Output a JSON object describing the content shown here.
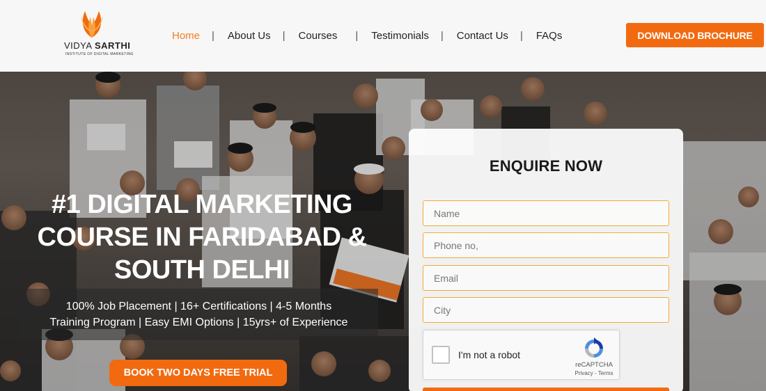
{
  "brand": {
    "name_part1": "VIDYA ",
    "name_part2": "SARTHI",
    "tagline": "INSTITUTE OF DIGITAL MARKETING",
    "accent_color": "#f26a10"
  },
  "nav": {
    "items": [
      {
        "label": "Home",
        "active": true
      },
      {
        "label": "About Us"
      },
      {
        "label": "Courses"
      },
      {
        "label": "Testimonials"
      },
      {
        "label": "Contact Us"
      },
      {
        "label": "FAQs"
      }
    ],
    "separator": "|"
  },
  "header": {
    "download_button": "DOWNLOAD BROCHURE"
  },
  "hero": {
    "headline_line1": "#1 DIGITAL MARKETING",
    "headline_line2": "COURSE IN FARIDABAD &",
    "headline_line3": "SOUTH DELHI",
    "sub_line1": "100% Job Placement | 16+ Certifications | 4-5 Months",
    "sub_line2": "Training Program | Easy EMI Options | 15yrs+ of Experience",
    "trial_button": "BOOK TWO DAYS FREE TRIAL"
  },
  "enquiry": {
    "title": "ENQUIRE NOW",
    "name_placeholder": "Name",
    "phone_placeholder": "Phone no,",
    "email_placeholder": "Email",
    "city_placeholder": "City",
    "field_border_color": "#f2a93b"
  },
  "recaptcha": {
    "label": "I'm not a robot",
    "name": "reCAPTCHA",
    "links": "Privacy - Terms",
    "icon": "recaptcha-icon"
  }
}
